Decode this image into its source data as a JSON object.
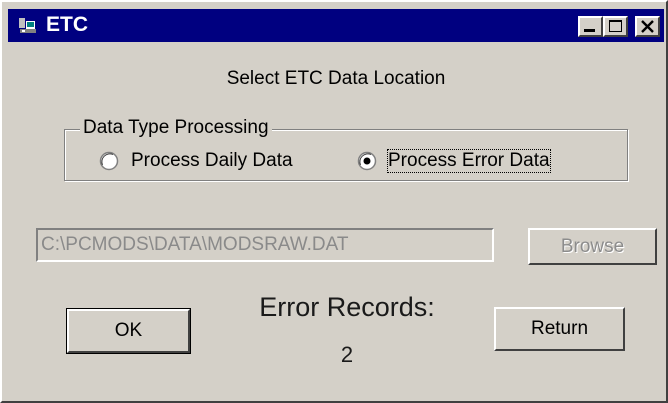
{
  "window": {
    "title": "ETC",
    "controls": [
      "minimize-icon",
      "maximize-icon",
      "close-icon"
    ]
  },
  "heading": "Select ETC Data Location",
  "data_type_group": {
    "legend": "Data Type Processing",
    "options": [
      {
        "label": "Process Daily Data",
        "selected": false
      },
      {
        "label": "Process Error Data",
        "selected": true
      }
    ]
  },
  "path_field": {
    "value": "C:\\PCMODS\\DATA\\MODSRAW.DAT",
    "enabled": false
  },
  "browse_button": {
    "label": "Browse",
    "enabled": false
  },
  "ok_button": {
    "label": "OK"
  },
  "return_button": {
    "label": "Return"
  },
  "error_records": {
    "label": "Error Records:",
    "count": "2"
  }
}
